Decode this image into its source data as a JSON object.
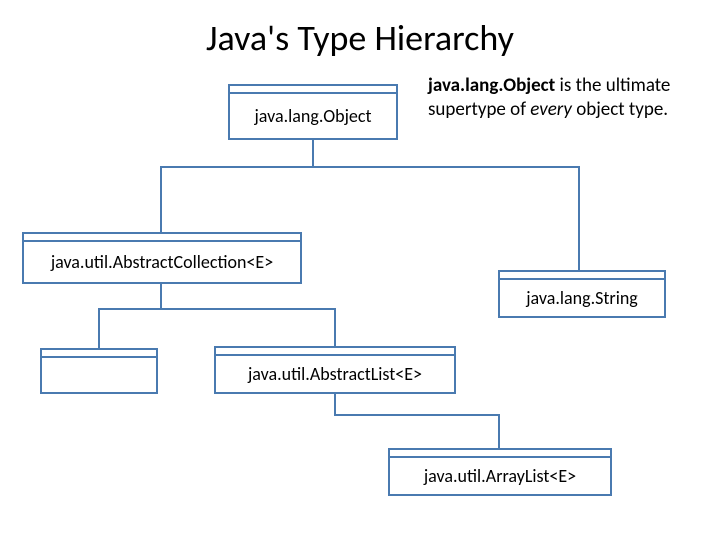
{
  "title": "Java's Type Hierarchy",
  "nodes": {
    "object": "java.lang.Object",
    "abstractCollection": "java.util.AbstractCollection<E>",
    "string": "java.lang.String",
    "abstractList": "java.util.AbstractList<E>",
    "arrayList": "java.util.ArrayList<E>",
    "empty": ""
  },
  "annotation": {
    "bold": "java.lang.Object",
    "mid1": " is the ultimate supertype of ",
    "italic": "every",
    "mid2": " object type."
  },
  "colors": {
    "border": "#4a7ab0"
  }
}
